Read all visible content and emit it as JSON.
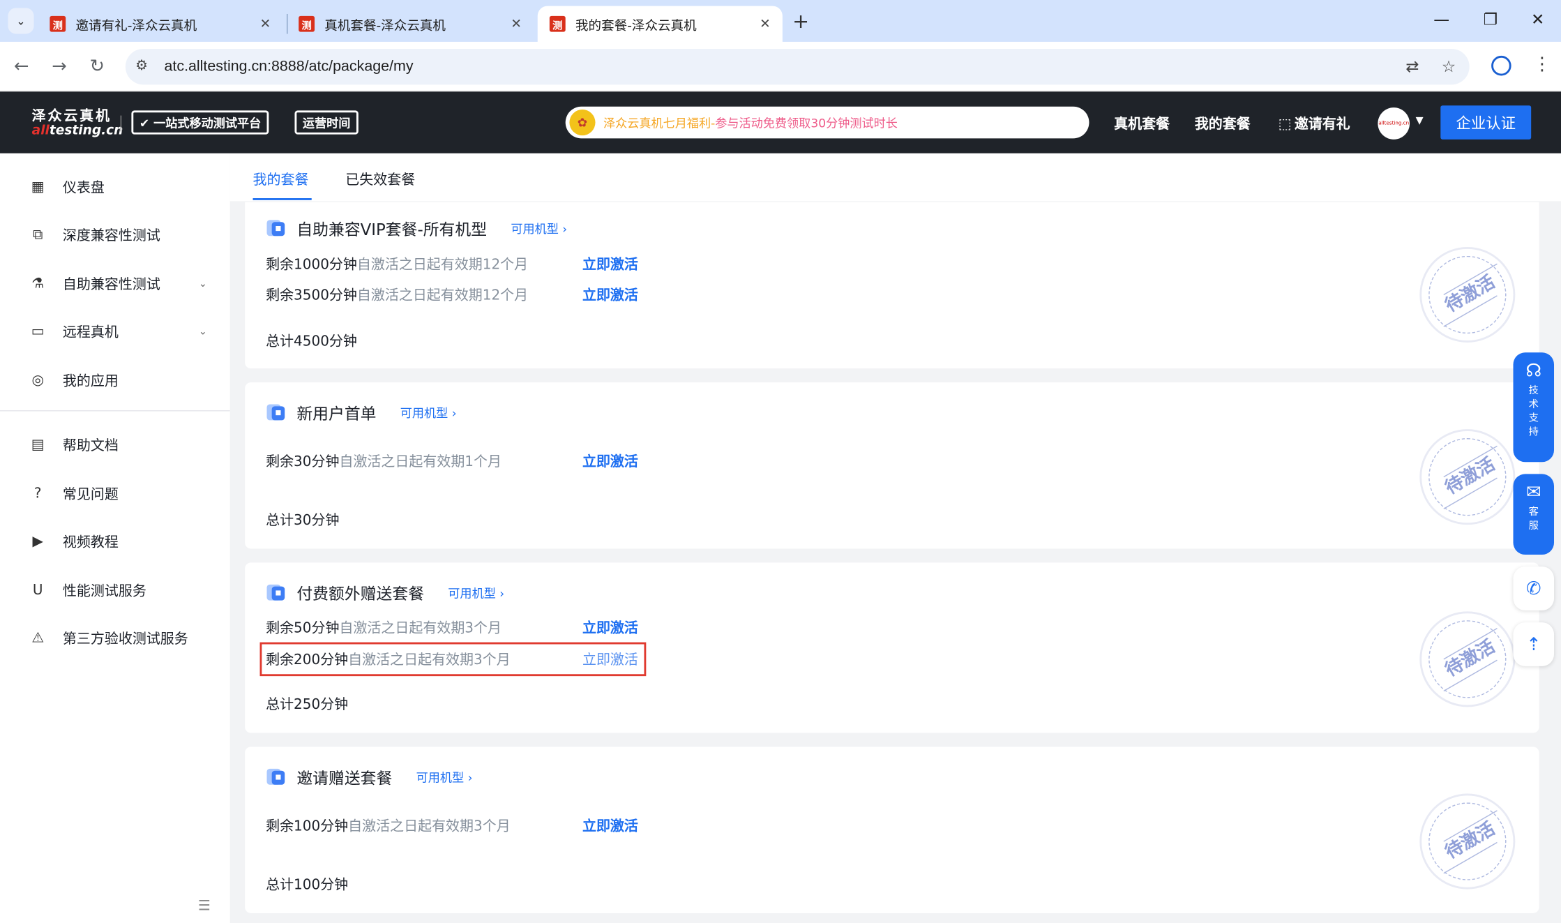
{
  "browser": {
    "tabs": [
      {
        "favicon": "测",
        "title": "邀请有礼-泽众云真机",
        "close": "✕"
      },
      {
        "favicon": "测",
        "title": "真机套餐-泽众云真机",
        "close": "✕"
      },
      {
        "favicon": "测",
        "title": "我的套餐-泽众云真机",
        "close": "✕"
      }
    ],
    "new_tab": "+",
    "url": "atc.alltesting.cn:8888/atc/package/my",
    "window": {
      "minimize": "—",
      "restore": "❐",
      "close": "✕"
    }
  },
  "header": {
    "logo_cn": "泽众云真机",
    "logo_en_red": "all",
    "logo_en_rest": "testing.cn",
    "badge_platform": "✔ 一站式移动测试平台",
    "badge_hours": "运营时间",
    "notice_orange": "泽众云真机七月福利-",
    "notice_pink": "参与活动免费领取30分钟测试时长",
    "nav": {
      "packages": "真机套餐",
      "my_packages": "我的套餐",
      "invite": "邀请有礼"
    },
    "avatar_text": "alltesting.cn",
    "cta": "企业认证"
  },
  "sidebar": {
    "items": [
      {
        "icon": "▦",
        "label": "仪表盘"
      },
      {
        "icon": "⧉",
        "label": "深度兼容性测试"
      },
      {
        "icon": "⚗",
        "label": "自助兼容性测试",
        "arrow": "⌄"
      },
      {
        "icon": "▭",
        "label": "远程真机",
        "arrow": "⌄"
      },
      {
        "icon": "◎",
        "label": "我的应用"
      },
      {
        "icon": "▤",
        "label": "帮助文档"
      },
      {
        "icon": "?",
        "label": "常见问题"
      },
      {
        "icon": "▶",
        "label": "视频教程"
      },
      {
        "icon": "U",
        "label": "性能测试服务"
      },
      {
        "icon": "⚠",
        "label": "第三方验收测试服务"
      }
    ],
    "collapse_icon": "☰"
  },
  "main": {
    "tabs": [
      "我的套餐",
      "已失效套餐"
    ],
    "model_link": "可用机型 ›",
    "activate": "立即激活",
    "stamp": "待激活",
    "cards": [
      {
        "title": "自助兼容VIP套餐-所有机型",
        "rows": [
          {
            "remain": "剩余1000分钟",
            "validity": "自激活之日起有效期12个月"
          },
          {
            "remain": "剩余3500分钟",
            "validity": "自激活之日起有效期12个月"
          }
        ],
        "total": "总计4500分钟"
      },
      {
        "title": "新用户首单",
        "rows": [
          {
            "remain": "剩余30分钟",
            "validity": "自激活之日起有效期1个月"
          }
        ],
        "total": "总计30分钟"
      },
      {
        "title": "付费额外赠送套餐",
        "rows": [
          {
            "remain": "剩余50分钟",
            "validity": "自激活之日起有效期3个月"
          },
          {
            "remain": "剩余200分钟",
            "validity": "自激活之日起有效期3个月"
          }
        ],
        "total": "总计250分钟"
      },
      {
        "title": "邀请赠送套餐",
        "rows": [
          {
            "remain": "剩余100分钟",
            "validity": "自激活之日起有效期3个月"
          }
        ],
        "total": "总计100分钟"
      }
    ]
  },
  "floating": {
    "support": "技术支持",
    "service": "客服"
  }
}
